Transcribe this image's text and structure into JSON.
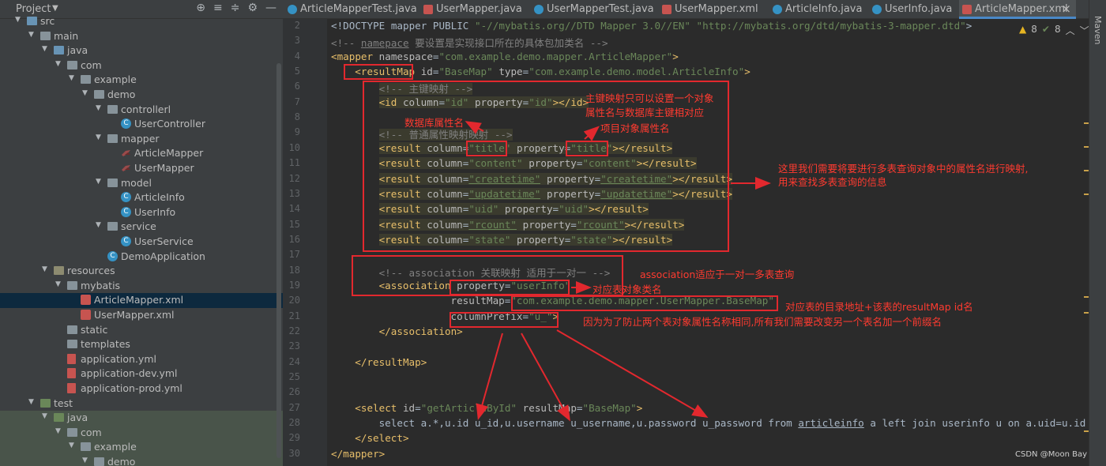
{
  "project": {
    "title": "Project",
    "tree": [
      {
        "label": "src",
        "indent": 1,
        "kind": "folder-src",
        "arrow": "v"
      },
      {
        "label": "main",
        "indent": 2,
        "kind": "folder",
        "arrow": "v"
      },
      {
        "label": "java",
        "indent": 3,
        "kind": "folder-src",
        "arrow": "v"
      },
      {
        "label": "com",
        "indent": 4,
        "kind": "folder",
        "arrow": "v"
      },
      {
        "label": "example",
        "indent": 5,
        "kind": "folder",
        "arrow": "v"
      },
      {
        "label": "demo",
        "indent": 6,
        "kind": "folder",
        "arrow": "v"
      },
      {
        "label": "controllerl",
        "indent": 7,
        "kind": "folder",
        "arrow": "v"
      },
      {
        "label": "UserController",
        "indent": 8,
        "kind": "class"
      },
      {
        "label": "mapper",
        "indent": 7,
        "kind": "folder",
        "arrow": "v"
      },
      {
        "label": "ArticleMapper",
        "indent": 8,
        "kind": "bird"
      },
      {
        "label": "UserMapper",
        "indent": 8,
        "kind": "bird"
      },
      {
        "label": "model",
        "indent": 7,
        "kind": "folder",
        "arrow": "v"
      },
      {
        "label": "ArticleInfo",
        "indent": 8,
        "kind": "class"
      },
      {
        "label": "UserInfo",
        "indent": 8,
        "kind": "class"
      },
      {
        "label": "service",
        "indent": 7,
        "kind": "folder",
        "arrow": "v"
      },
      {
        "label": "UserService",
        "indent": 8,
        "kind": "class"
      },
      {
        "label": "DemoApplication",
        "indent": 7,
        "kind": "class"
      },
      {
        "label": "resources",
        "indent": 3,
        "kind": "folder-res",
        "arrow": "v"
      },
      {
        "label": "mybatis",
        "indent": 4,
        "kind": "folder",
        "arrow": "v"
      },
      {
        "label": "ArticleMapper.xml",
        "indent": 5,
        "kind": "xml",
        "selected": true
      },
      {
        "label": "UserMapper.xml",
        "indent": 5,
        "kind": "xml"
      },
      {
        "label": "static",
        "indent": 4,
        "kind": "folder"
      },
      {
        "label": "templates",
        "indent": 4,
        "kind": "folder"
      },
      {
        "label": "application.yml",
        "indent": 4,
        "kind": "yml"
      },
      {
        "label": "application-dev.yml",
        "indent": 4,
        "kind": "yml"
      },
      {
        "label": "application-prod.yml",
        "indent": 4,
        "kind": "yml"
      },
      {
        "label": "test",
        "indent": 2,
        "kind": "folder-test",
        "arrow": "v"
      },
      {
        "label": "java",
        "indent": 3,
        "kind": "folder-test",
        "arrow": "v",
        "testbg": true
      },
      {
        "label": "com",
        "indent": 4,
        "kind": "folder",
        "arrow": "v",
        "testbg": true
      },
      {
        "label": "example",
        "indent": 5,
        "kind": "folder",
        "arrow": "v",
        "testbg": true
      },
      {
        "label": "demo",
        "indent": 6,
        "kind": "folder",
        "arrow": "v",
        "testbg": true
      }
    ]
  },
  "tabs": [
    {
      "label": "ArticleMapperTest.java",
      "icon": "class"
    },
    {
      "label": "UserMapper.java",
      "icon": "bird"
    },
    {
      "label": "UserMapperTest.java",
      "icon": "class"
    },
    {
      "label": "UserMapper.xml",
      "icon": "xml"
    },
    {
      "label": "ArticleInfo.java",
      "icon": "class"
    },
    {
      "label": "UserInfo.java",
      "icon": "class"
    },
    {
      "label": "ArticleMapper.xml",
      "icon": "xml",
      "active": true
    }
  ],
  "side_tool": "Maven",
  "inspection": {
    "warnings": "8",
    "ok": "8"
  },
  "code_lines": [
    {
      "n": "2",
      "indent": 0,
      "parts": [
        [
          "plain",
          "<!DOCTYPE mapper PUBLIC "
        ],
        [
          "val",
          "\"-//mybatis.org//DTD Mapper 3.0//EN\""
        ],
        [
          "plain",
          " "
        ],
        [
          "val",
          "\"http://mybatis.org/dtd/mybatis-3-mapper.dtd\""
        ],
        [
          "plain",
          ">"
        ]
      ]
    },
    {
      "n": "3",
      "indent": 0,
      "parts": [
        [
          "cmt",
          "<!-- "
        ],
        [
          "cmt-u",
          "namepace"
        ],
        [
          "cmt",
          " 要设置是实现接口所在的具体包加类名 -->"
        ]
      ]
    },
    {
      "n": "4",
      "indent": 0,
      "parts": [
        [
          "tag",
          "<mapper "
        ],
        [
          "attr",
          "namespace"
        ],
        [
          "plain",
          "="
        ],
        [
          "val",
          "\"com.example.demo.mapper.ArticleMapper\""
        ],
        [
          "tag",
          ">"
        ]
      ]
    },
    {
      "n": "5",
      "indent": 1,
      "parts": [
        [
          "tag",
          "<resultMap "
        ],
        [
          "attr",
          "id"
        ],
        [
          "plain",
          "="
        ],
        [
          "val",
          "\"BaseMap\""
        ],
        [
          "plain",
          " "
        ],
        [
          "attr",
          "type"
        ],
        [
          "plain",
          "="
        ],
        [
          "val",
          "\"com.example.demo.model.ArticleInfo\""
        ],
        [
          "tag",
          ">"
        ]
      ]
    },
    {
      "n": "6",
      "indent": 2,
      "hl": true,
      "parts": [
        [
          "cmt",
          "<!-- 主键映射 -->"
        ]
      ]
    },
    {
      "n": "7",
      "indent": 2,
      "hl": true,
      "parts": [
        [
          "tag",
          "<id "
        ],
        [
          "attr",
          "column"
        ],
        [
          "plain",
          "="
        ],
        [
          "val",
          "\"id\""
        ],
        [
          "plain",
          " "
        ],
        [
          "attr",
          "property"
        ],
        [
          "plain",
          "="
        ],
        [
          "val",
          "\"id\""
        ],
        [
          "tag",
          "></id>"
        ]
      ]
    },
    {
      "n": "8",
      "indent": 2,
      "parts": []
    },
    {
      "n": "9",
      "indent": 2,
      "hl": true,
      "parts": [
        [
          "cmt",
          "<!-- 普通属性映射映射 -->"
        ]
      ]
    },
    {
      "n": "10",
      "indent": 2,
      "hl": true,
      "parts": [
        [
          "tag",
          "<result "
        ],
        [
          "attr",
          "column"
        ],
        [
          "plain",
          "="
        ],
        [
          "val",
          "\"title\""
        ],
        [
          "plain",
          " "
        ],
        [
          "attr",
          "property"
        ],
        [
          "plain",
          "="
        ],
        [
          "val",
          "\"title\""
        ],
        [
          "tag",
          "></result>"
        ]
      ]
    },
    {
      "n": "11",
      "indent": 2,
      "hl": true,
      "parts": [
        [
          "tag",
          "<result "
        ],
        [
          "attr",
          "column"
        ],
        [
          "plain",
          "="
        ],
        [
          "val",
          "\"content\""
        ],
        [
          "plain",
          " "
        ],
        [
          "attr",
          "property"
        ],
        [
          "plain",
          "="
        ],
        [
          "val",
          "\"content\""
        ],
        [
          "tag",
          "></result>"
        ]
      ]
    },
    {
      "n": "12",
      "indent": 2,
      "hl": true,
      "parts": [
        [
          "tag",
          "<result "
        ],
        [
          "attr",
          "column"
        ],
        [
          "plain",
          "="
        ],
        [
          "val-u",
          "\"createtime\""
        ],
        [
          "plain",
          " "
        ],
        [
          "attr",
          "property"
        ],
        [
          "plain",
          "="
        ],
        [
          "val-u",
          "\"createtime\""
        ],
        [
          "tag",
          "></result>"
        ]
      ]
    },
    {
      "n": "13",
      "indent": 2,
      "hl": true,
      "parts": [
        [
          "tag",
          "<result "
        ],
        [
          "attr",
          "column"
        ],
        [
          "plain",
          "="
        ],
        [
          "val-u",
          "\"updatetime\""
        ],
        [
          "plain",
          " "
        ],
        [
          "attr",
          "property"
        ],
        [
          "plain",
          "="
        ],
        [
          "val-u",
          "\"updatetime\""
        ],
        [
          "tag",
          "></result>"
        ]
      ]
    },
    {
      "n": "14",
      "indent": 2,
      "hl": true,
      "parts": [
        [
          "tag",
          "<result "
        ],
        [
          "attr",
          "column"
        ],
        [
          "plain",
          "="
        ],
        [
          "val",
          "\"uid\""
        ],
        [
          "plain",
          " "
        ],
        [
          "attr",
          "property"
        ],
        [
          "plain",
          "="
        ],
        [
          "val",
          "\"uid\""
        ],
        [
          "tag",
          "></result>"
        ]
      ]
    },
    {
      "n": "15",
      "indent": 2,
      "hl": true,
      "parts": [
        [
          "tag",
          "<result "
        ],
        [
          "attr",
          "column"
        ],
        [
          "plain",
          "="
        ],
        [
          "val-u",
          "\"rcount\""
        ],
        [
          "plain",
          " "
        ],
        [
          "attr",
          "property"
        ],
        [
          "plain",
          "="
        ],
        [
          "val-u",
          "\"rcount\""
        ],
        [
          "tag",
          "></result>"
        ]
      ]
    },
    {
      "n": "16",
      "indent": 2,
      "hl": true,
      "parts": [
        [
          "tag",
          "<result "
        ],
        [
          "attr",
          "column"
        ],
        [
          "plain",
          "="
        ],
        [
          "val",
          "\"state\""
        ],
        [
          "plain",
          " "
        ],
        [
          "attr",
          "property"
        ],
        [
          "plain",
          "="
        ],
        [
          "val",
          "\"state\""
        ],
        [
          "tag",
          "></result>"
        ]
      ]
    },
    {
      "n": "17",
      "indent": 2,
      "parts": []
    },
    {
      "n": "18",
      "indent": 2,
      "parts": [
        [
          "cmt",
          "<!-- association 关联映射 适用于一对一 -->"
        ]
      ]
    },
    {
      "n": "19",
      "indent": 2,
      "parts": [
        [
          "tag",
          "<association "
        ],
        [
          "attr",
          "property"
        ],
        [
          "plain",
          "="
        ],
        [
          "val",
          "\"userInfo\""
        ]
      ]
    },
    {
      "n": "20",
      "indent": 5,
      "parts": [
        [
          "attr",
          "resultMap"
        ],
        [
          "plain",
          "="
        ],
        [
          "val",
          "\"com.example.demo.mapper.UserMapper.BaseMap\""
        ]
      ]
    },
    {
      "n": "21",
      "indent": 5,
      "parts": [
        [
          "attr",
          "columnPrefix"
        ],
        [
          "plain",
          "="
        ],
        [
          "val",
          "\"u_\""
        ],
        [
          "tag",
          ">"
        ]
      ]
    },
    {
      "n": "22",
      "indent": 2,
      "parts": [
        [
          "tag",
          "</association>"
        ]
      ]
    },
    {
      "n": "23",
      "indent": 1,
      "parts": []
    },
    {
      "n": "24",
      "indent": 1,
      "parts": [
        [
          "tag",
          "</resultMap>"
        ]
      ]
    },
    {
      "n": "25",
      "indent": 1,
      "parts": []
    },
    {
      "n": "26",
      "indent": 1,
      "parts": []
    },
    {
      "n": "27",
      "indent": 1,
      "parts": [
        [
          "tag",
          "<select "
        ],
        [
          "attr",
          "id"
        ],
        [
          "plain",
          "="
        ],
        [
          "val",
          "\"getArticleById\""
        ],
        [
          "plain",
          " "
        ],
        [
          "attr",
          "resultMap"
        ],
        [
          "plain",
          "="
        ],
        [
          "val",
          "\"BaseMap\""
        ],
        [
          "tag",
          ">"
        ]
      ]
    },
    {
      "n": "28",
      "indent": 2,
      "parts": [
        [
          "plain",
          "select a.*,u.id u_id,u.username u_username,u.password u_password from "
        ],
        [
          "plain-u",
          "articleinfo"
        ],
        [
          "plain",
          " a left join userinfo u on a.uid=u.id whe"
        ]
      ]
    },
    {
      "n": "29",
      "indent": 1,
      "parts": [
        [
          "tag",
          "</select>"
        ]
      ]
    },
    {
      "n": "30",
      "indent": 0,
      "parts": [
        [
          "tag",
          "</mapper>"
        ]
      ]
    }
  ],
  "annotations": {
    "pk_note_1": "主键映射只可以设置一个对象",
    "pk_note_2": "属性名与数据库主键相对应",
    "db_attr": "数据库属性名",
    "obj_attr": "项目对象属性名",
    "multi_1": "这里我们需要将要进行多表查询对象中的属性名进行映射,",
    "multi_2": "用来查找多表查询的信息",
    "assoc": "association适应于一对一多表查询",
    "class_name": "对应表对象类名",
    "result_map": "对应表的目录地址+该表的resultMap id名",
    "prefix": "因为为了防止两个表对象属性名称相同,所有我们需要改变另一个表名加一个前缀名"
  },
  "watermark": "CSDN @Moon Bay"
}
